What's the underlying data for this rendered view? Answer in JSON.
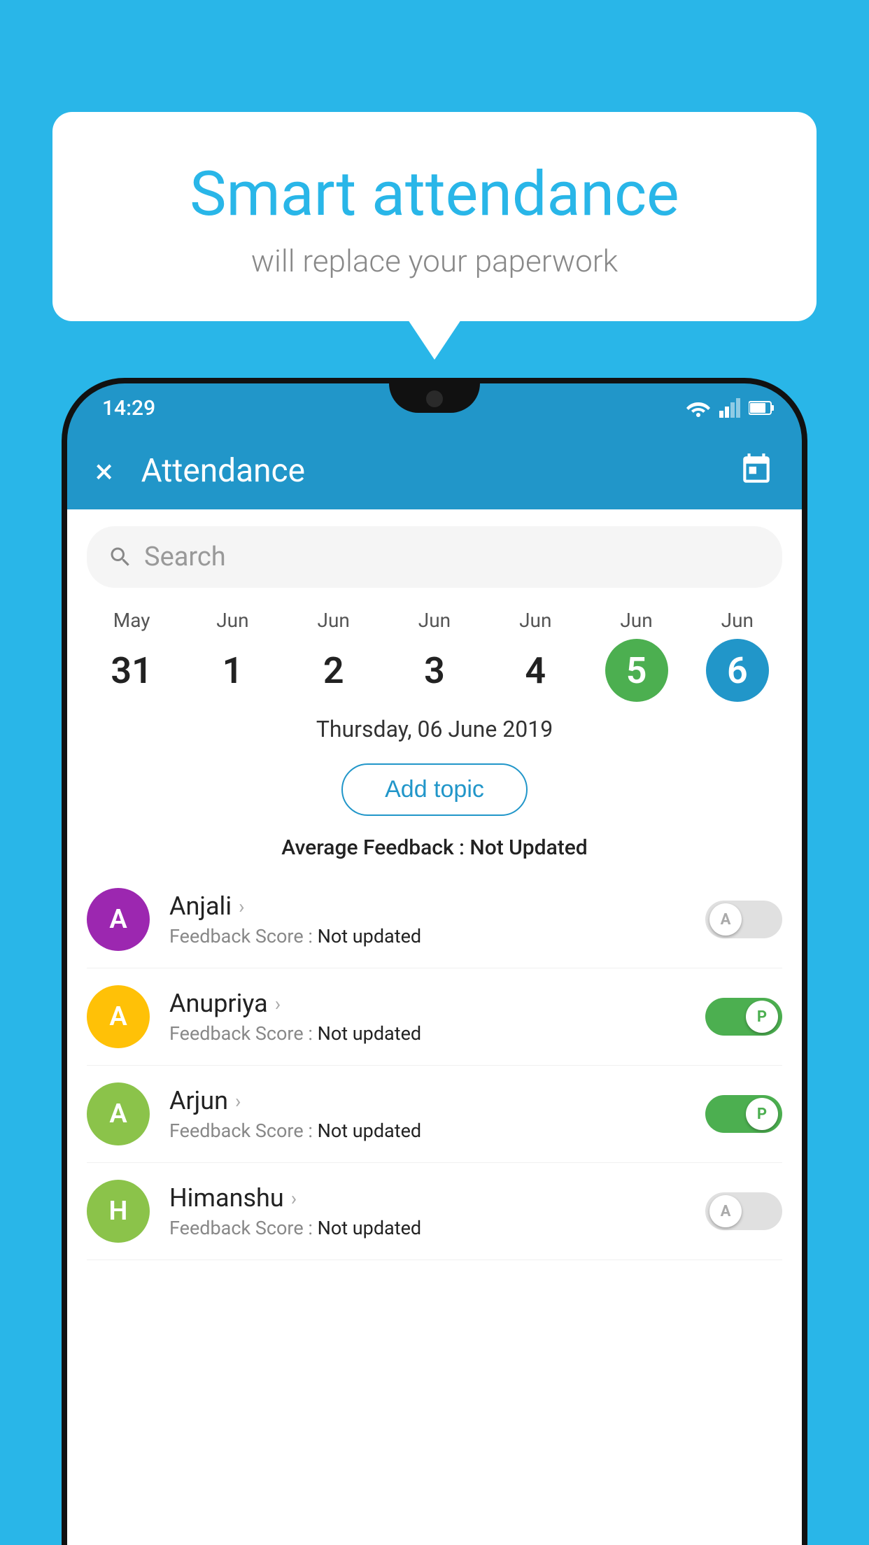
{
  "background_color": "#29b6e8",
  "bubble": {
    "title": "Smart attendance",
    "subtitle": "will replace your paperwork"
  },
  "status_bar": {
    "time": "14:29"
  },
  "header": {
    "title": "Attendance",
    "close_label": "×"
  },
  "search": {
    "placeholder": "Search"
  },
  "calendar": {
    "days": [
      {
        "month": "May",
        "date": "31",
        "state": "normal"
      },
      {
        "month": "Jun",
        "date": "1",
        "state": "normal"
      },
      {
        "month": "Jun",
        "date": "2",
        "state": "normal"
      },
      {
        "month": "Jun",
        "date": "3",
        "state": "normal"
      },
      {
        "month": "Jun",
        "date": "4",
        "state": "normal"
      },
      {
        "month": "Jun",
        "date": "5",
        "state": "today"
      },
      {
        "month": "Jun",
        "date": "6",
        "state": "selected"
      }
    ]
  },
  "date_label": "Thursday, 06 June 2019",
  "add_topic_label": "Add topic",
  "average_feedback_label": "Average Feedback : ",
  "average_feedback_value": "Not Updated",
  "students": [
    {
      "name": "Anjali",
      "avatar_letter": "A",
      "avatar_color": "#9c27b0",
      "feedback_label": "Feedback Score : ",
      "feedback_value": "Not updated",
      "toggle_state": "off",
      "toggle_label": "A"
    },
    {
      "name": "Anupriya",
      "avatar_letter": "A",
      "avatar_color": "#ffc107",
      "feedback_label": "Feedback Score : ",
      "feedback_value": "Not updated",
      "toggle_state": "on",
      "toggle_label": "P"
    },
    {
      "name": "Arjun",
      "avatar_letter": "A",
      "avatar_color": "#8bc34a",
      "feedback_label": "Feedback Score : ",
      "feedback_value": "Not updated",
      "toggle_state": "on",
      "toggle_label": "P"
    },
    {
      "name": "Himanshu",
      "avatar_letter": "H",
      "avatar_color": "#8bc34a",
      "feedback_label": "Feedback Score : ",
      "feedback_value": "Not updated",
      "toggle_state": "off",
      "toggle_label": "A"
    }
  ]
}
